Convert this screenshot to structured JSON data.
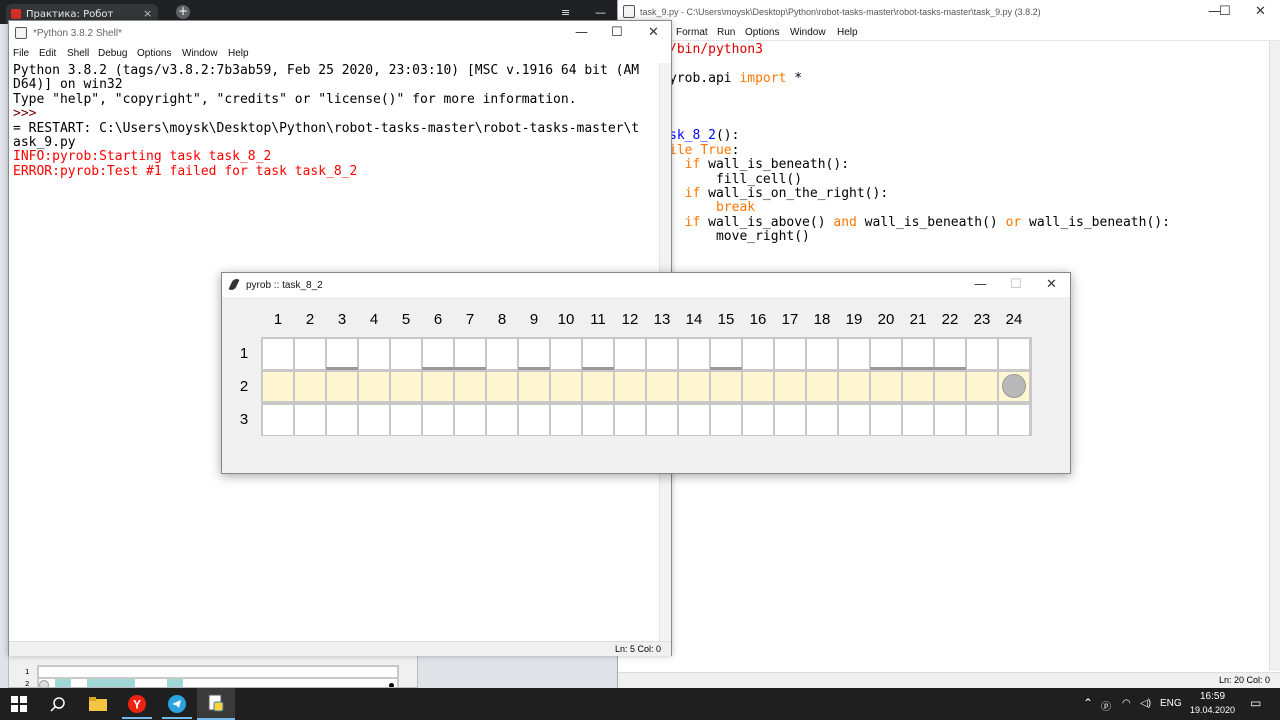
{
  "browser": {
    "tab_title": "Практика: Робот",
    "tab_close": "×",
    "new_tab": "+",
    "menu_glyph": "≡",
    "minimize": "—"
  },
  "editor": {
    "title": "task_9.py - C:\\Users\\moysk\\Desktop\\Python\\robot-tasks-master\\robot-tasks-master\\task_9.py (3.8.2)",
    "menu": [
      "Format",
      "Run",
      "Options",
      "Window",
      "Help"
    ],
    "code_lines": [
      [
        {
          "t": "/bin/python3",
          "c": "str"
        }
      ],
      [],
      [
        {
          "t": "yrob.api ",
          "c": ""
        },
        {
          "t": "import",
          "c": "kw"
        },
        {
          "t": " *",
          "c": ""
        }
      ],
      [],
      [],
      [],
      [
        {
          "t": "sk_8_2",
          "c": "fn"
        },
        {
          "t": "():",
          "c": ""
        }
      ],
      [
        {
          "t": "ile ",
          "c": "kw"
        },
        {
          "t": "True",
          "c": "kw"
        },
        {
          "t": ":",
          "c": ""
        }
      ],
      [
        {
          "t": "  ",
          "c": ""
        },
        {
          "t": "if",
          "c": "kw"
        },
        {
          "t": " wall_is_beneath():",
          "c": ""
        }
      ],
      [
        {
          "t": "      fill_cell()",
          "c": ""
        }
      ],
      [
        {
          "t": "  ",
          "c": ""
        },
        {
          "t": "if",
          "c": "kw"
        },
        {
          "t": " wall_is_on_the_right():",
          "c": ""
        }
      ],
      [
        {
          "t": "      ",
          "c": ""
        },
        {
          "t": "break",
          "c": "kw"
        }
      ],
      [
        {
          "t": "  ",
          "c": ""
        },
        {
          "t": "if",
          "c": "kw"
        },
        {
          "t": " wall_is_above() ",
          "c": ""
        },
        {
          "t": "and",
          "c": "kw"
        },
        {
          "t": " wall_is_beneath() ",
          "c": ""
        },
        {
          "t": "or",
          "c": "kw"
        },
        {
          "t": " wall_is_beneath():",
          "c": ""
        }
      ],
      [
        {
          "t": "      move_right()",
          "c": ""
        }
      ]
    ],
    "status": "Ln: 20   Col: 0"
  },
  "shell": {
    "title": "*Python 3.8.2 Shell*",
    "menu": [
      "File",
      "Edit",
      "Shell",
      "Debug",
      "Options",
      "Window",
      "Help"
    ],
    "lines": [
      {
        "t": "Python 3.8.2 (tags/v3.8.2:7b3ab59, Feb 25 2020, 23:03:10) [MSC v.1916 64 bit (AM",
        "c": "sh-out"
      },
      {
        "t": "D64)] on win32",
        "c": "sh-out"
      },
      {
        "t": "Type \"help\", \"copyright\", \"credits\" or \"license()\" for more information.",
        "c": "sh-out"
      },
      {
        "t": ">>> ",
        "c": "sh-prompt"
      },
      {
        "t": "= RESTART: C:\\Users\\moysk\\Desktop\\Python\\robot-tasks-master\\robot-tasks-master\\t",
        "c": "sh-out"
      },
      {
        "t": "ask_9.py",
        "c": "sh-out"
      },
      {
        "t": "INFO:pyrob:Starting task task_8_2",
        "c": "sh-err"
      },
      {
        "t": "ERROR:pyrob:Test #1 failed for task task_8_2",
        "c": "sh-err"
      }
    ],
    "status": "Ln: 5   Col: 0"
  },
  "pyrob": {
    "title": "pyrob :: task_8_2",
    "columns": [
      "1",
      "2",
      "3",
      "4",
      "5",
      "6",
      "7",
      "8",
      "9",
      "10",
      "11",
      "12",
      "13",
      "14",
      "15",
      "16",
      "17",
      "18",
      "19",
      "20",
      "21",
      "22",
      "23",
      "24"
    ],
    "rows": [
      "1",
      "2",
      "3"
    ],
    "filled_row": 2,
    "robot_row": 2,
    "robot_col": 24,
    "walls_above_row2_cols": [
      3,
      6,
      7,
      9,
      11,
      15,
      20,
      21,
      22
    ]
  },
  "bgpreview": {
    "row_labels": [
      "1",
      "2"
    ]
  },
  "taskbar": {
    "lang": "ENG",
    "time": "16:59",
    "date": "19.04.2020"
  },
  "colors": {
    "filled_cell": "#fff7d1",
    "wall": "#9a9a9a",
    "robot": "#b9b9b9",
    "error_text": "#ff0000",
    "keyword": "#ff7700"
  },
  "icons": {
    "start": "windows-logo-icon",
    "search": "search-icon",
    "explorer": "folder-icon",
    "yandex": "yandex-browser-icon",
    "telegram": "telegram-icon",
    "idle": "python-idle-icon"
  }
}
